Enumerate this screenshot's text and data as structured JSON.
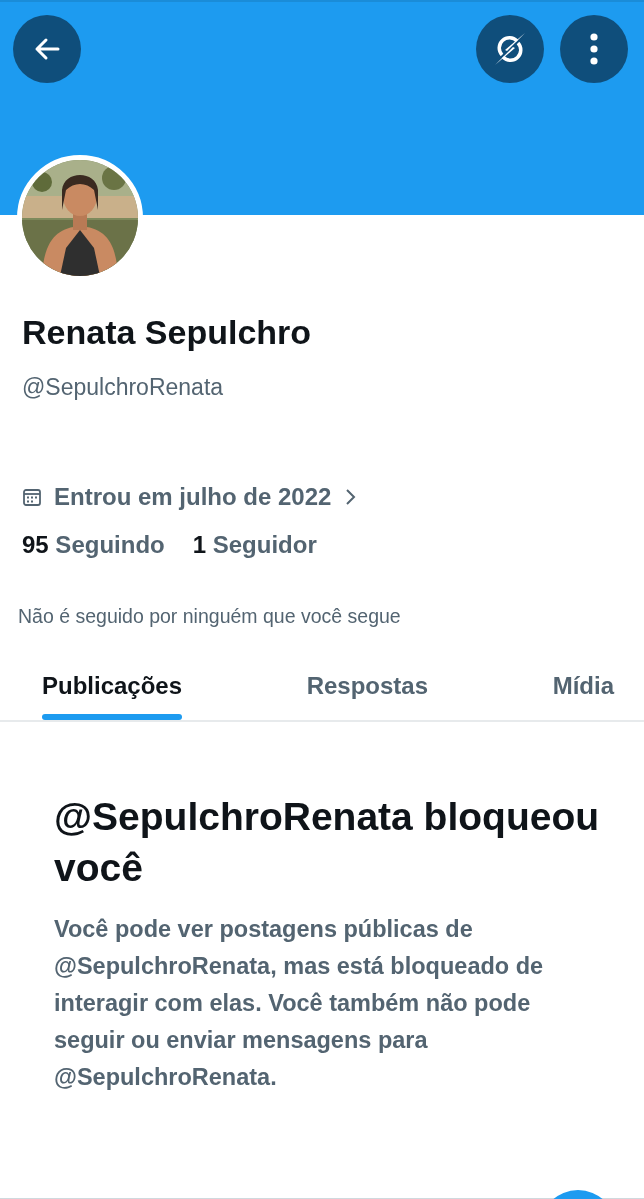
{
  "profile": {
    "name": "Renata Sepulchro",
    "handle": "@SepulchroRenata",
    "joined": "Entrou em julho de 2022",
    "stats": [
      {
        "count": "95",
        "label": "Seguindo"
      },
      {
        "count": "1",
        "label": "Seguidor"
      }
    ],
    "followed_by": "Não é seguido por ninguém que você segue"
  },
  "tabs": [
    {
      "label": "Publicações",
      "selected": true
    },
    {
      "label": "Respostas",
      "selected": false
    },
    {
      "label": "Mídia",
      "selected": false
    }
  ],
  "blocked": {
    "title": "@SepulchroRenata bloqueou você",
    "message": "Você pode ver postagens públicas de @SepulchroRenata, mas está bloqueado de interagir com elas. Você também não pode seguir ou enviar mensagens para @SepulchroRenata."
  }
}
